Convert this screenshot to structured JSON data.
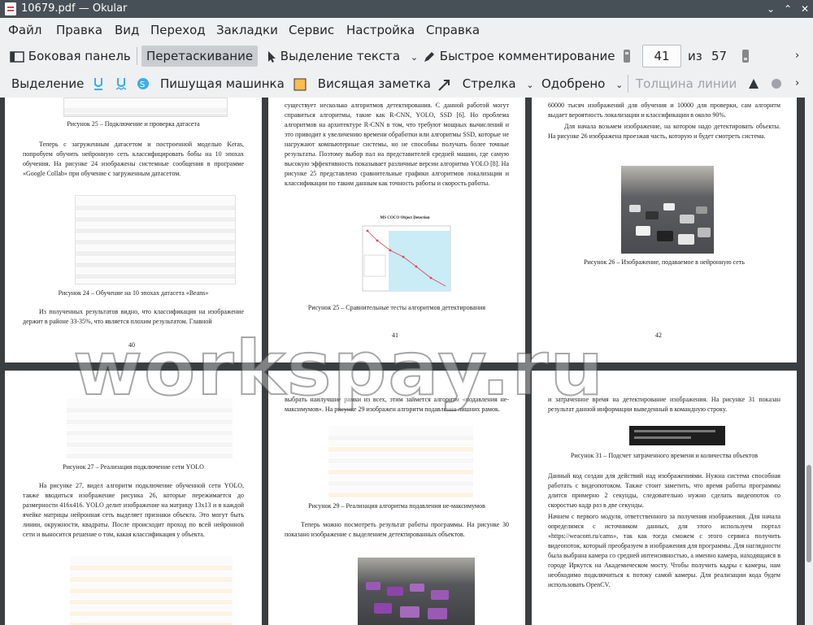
{
  "window": {
    "title": "10679.pdf — Okular"
  },
  "menu": [
    "Файл",
    "Правка",
    "Вид",
    "Переход",
    "Закладки",
    "Сервис",
    "Настройка",
    "Справка"
  ],
  "toolbar1": {
    "sidebar": "Боковая панель",
    "drag": "Перетаскивание",
    "text_select": "Выделение текста",
    "quick_comment": "Быстрое комментирование",
    "page_current": "41",
    "of_label": "из",
    "page_total": "57"
  },
  "toolbar2": {
    "highlight": "Выделение",
    "typewriter": "Пишущая машинка",
    "note": "Висящая заметка",
    "arrow": "Стрелка",
    "stamp": "Одобрено",
    "line_width": "Толщина линии"
  },
  "watermark": "workspay.ru",
  "pages": {
    "p40": {
      "cap25": "Рисунок 25 – Подключение и проверка датасета",
      "text1": "Теперь с загруженным датасетом и построенной моделью Keras, попробуем обучить нейронную сеть классифицировать бобы на 10 эпохах обучения. На рисунке 24 изображены системные сообщения в программе «Google Collab» при обучение с загруженным датасетом.",
      "cap24": "Рисунок 24 – Обучение на 10 эпохах датасета «Beans»",
      "text2": "Из полученных результатов видно, что классификация на изображение держит в районе 33-35%, что является плохим результатом. Главной",
      "num": "40"
    },
    "p41": {
      "text1": "существует несколько алгоритмов детектирования. С данной работой могут справиться алгоритмы, такие как R-CNN, YOLO, SSD [6]. Но проблема алгоритмов на архитектуре R-CNN в том, что требуют мощных вычислений и это приводит к увеличению времени обработки или алгоритмы SSD, которые не нагружают компьютерные системы, но не способны получать более точные результаты. Поэтому выбор пал на представителей средней машин, где самую высокую эффективность показывает различные версии алгоритма YOLO [8]. На рисунке 25 представлено сравнительные графики алгоритмов локализации и классификации по таким данным как точность работы и скорость работы.",
      "chart_title": "MS COCO Object Detection",
      "cap25": "Рисунок 25 – Сравнительные тесты алгоритмов детектирования",
      "num": "41"
    },
    "p42": {
      "text1": "60000 тысяч изображений для обучения и 10000 для проверки, сам алгоритм выдает вероятность локализации и классификации в около 90%.",
      "text2": "Для начала возьмем изображение, на котором надо детектировать объекты. На рисунке 26 изображена проезжая часть, которую и будет смотреть система.",
      "cap26": "Рисунок 26 – Изображение, подаваемое в нейронную сеть",
      "num": "42"
    },
    "p43": {
      "cap27": "Рисунок 27 – Реализация подключение сети YOLO",
      "text1": "На рисунке 27, видел алгоритм подключение обученной сети YOLO, также вводиться изображение рисунка 26, которые пережимается до размерности 416x416. YOLO делит изображение на матрицу 13x13 и в каждой ячейке матрицы нейронная сеть выделяет признаки объекта. Это могут быть линии, окружности, квадраты. После происходит проход по всей нейронной сети и выносится решение о том, какая классификация у объекта."
    },
    "p44": {
      "text1": "выбрать наилучшие рамки из всех, этим займется алгоритм «подавления не-максимумов». На рисунке 29 изображен алгоритм подавления лишних рамок.",
      "cap29": "Рисунок 29 – Реализация алгоритма подавления не-максимумов",
      "text2": "Теперь можно посмотреть результат работы программы. На рисунке 30 показано изображение с выделением детектированных объектов."
    },
    "p45": {
      "text1": "и затраченное время на детектирование изображения. На рисунке 31 показан результат данной информации выведенный в командную строку.",
      "cap31": "Рисунок 31 – Подсчет затраченного времени и количества объектов",
      "text2": "Данный код создан для действий над изображениями. Нужна система способная работать с видеопотоком. Также стоит заметить, что время работы программы длится примерно 2 секунды, следовательно нужно сделать видеопоток со скоростью кадр раз в две секунды.",
      "text3": "Начнем с первого модуля, ответственного за получения изображения. Для начала определимся с источником данных, для этого используем портал «https://weacom.ru/cams», так как тогда сможем с этого сервиса получить видеопоток, который преобразуем в изображения для программы. Для наглядности была выбрана камера со средней интенсивностью, а именно камера, находящаяся в городе Иркутск на Академическом мосту. Чтобы получить кадры с камеры, нам необходимо подключиться к потоку самой камеры. Для реализации кода будем использовать OpenCV."
    }
  }
}
